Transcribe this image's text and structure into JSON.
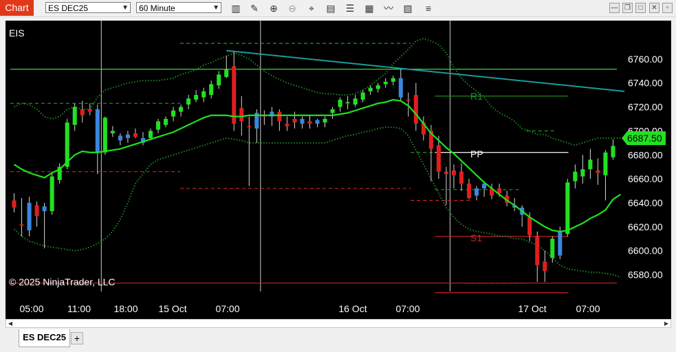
{
  "toolbar": {
    "chart_tab": "Chart",
    "instrument": "ES DEC25",
    "interval": "60 Minute",
    "icons": [
      "bar-type-icon",
      "pencil-icon",
      "zoom-in-icon",
      "zoom-out-icon",
      "crosshair-icon",
      "data-box-icon",
      "properties-icon",
      "strategies-icon",
      "indicators-icon",
      "templates-icon"
    ]
  },
  "window_buttons": {
    "minimize": "—",
    "restore": "❐",
    "maximize": "□",
    "close": "✕"
  },
  "chart": {
    "instrument_label": "EIS",
    "copyright": "© 2025 NinjaTrader, LLC",
    "current_price": "6687.50",
    "level_labels": {
      "r1": "R1",
      "pp": "PP",
      "s1": "S1"
    }
  },
  "chart_data": {
    "type": "candlestick",
    "title": "EIS",
    "y_ticks": [
      "6760.00",
      "6740.00",
      "6720.00",
      "6700.00",
      "6680.00",
      "6660.00",
      "6640.00",
      "6620.00",
      "6600.00",
      "6580.00"
    ],
    "ylim": [
      6566,
      6792
    ],
    "x_ticks": [
      "05:00",
      "11:00",
      "18:00",
      "15 Oct",
      "07:00",
      "16 Oct",
      "07:00",
      "17 Oct",
      "07:00"
    ],
    "candles": [
      {
        "o": 6642,
        "h": 6648,
        "l": 6632,
        "c": 6636,
        "color": "red"
      },
      {
        "o": 6622,
        "h": 6644,
        "l": 6612,
        "c": 6621,
        "color": "red"
      },
      {
        "o": 6617,
        "h": 6645,
        "l": 6612,
        "c": 6640,
        "color": "blue"
      },
      {
        "o": 6638,
        "h": 6641,
        "l": 6620,
        "c": 6629,
        "color": "red"
      },
      {
        "o": 6633,
        "h": 6640,
        "l": 6602,
        "c": 6637,
        "color": "blue"
      },
      {
        "o": 6633,
        "h": 6666,
        "l": 6630,
        "c": 6662,
        "color": "green"
      },
      {
        "o": 6659,
        "h": 6673,
        "l": 6656,
        "c": 6670,
        "color": "green"
      },
      {
        "o": 6670,
        "h": 6710,
        "l": 6668,
        "c": 6707,
        "color": "green"
      },
      {
        "o": 6705,
        "h": 6723,
        "l": 6700,
        "c": 6720,
        "color": "green"
      },
      {
        "o": 6718,
        "h": 6725,
        "l": 6707,
        "c": 6713,
        "color": "red"
      },
      {
        "o": 6718,
        "h": 6723,
        "l": 6713,
        "c": 6716,
        "color": "red"
      },
      {
        "o": 6718,
        "h": 6722,
        "l": 6664,
        "c": 6682,
        "color": "blue"
      },
      {
        "o": 6682,
        "h": 6712,
        "l": 6680,
        "c": 6711,
        "color": "green"
      },
      {
        "o": 6698,
        "h": 6704,
        "l": 6695,
        "c": 6700,
        "color": "green"
      },
      {
        "o": 6692,
        "h": 6698,
        "l": 6688,
        "c": 6696,
        "color": "blue"
      },
      {
        "o": 6694,
        "h": 6700,
        "l": 6690,
        "c": 6697,
        "color": "blue"
      },
      {
        "o": 6698,
        "h": 6702,
        "l": 6694,
        "c": 6695,
        "color": "red"
      },
      {
        "o": 6690,
        "h": 6699,
        "l": 6688,
        "c": 6694,
        "color": "blue"
      },
      {
        "o": 6694,
        "h": 6702,
        "l": 6692,
        "c": 6700,
        "color": "green"
      },
      {
        "o": 6701,
        "h": 6710,
        "l": 6698,
        "c": 6708,
        "color": "green"
      },
      {
        "o": 6705,
        "h": 6712,
        "l": 6703,
        "c": 6710,
        "color": "green"
      },
      {
        "o": 6712,
        "h": 6720,
        "l": 6708,
        "c": 6717,
        "color": "green"
      },
      {
        "o": 6716,
        "h": 6722,
        "l": 6712,
        "c": 6720,
        "color": "green"
      },
      {
        "o": 6722,
        "h": 6730,
        "l": 6718,
        "c": 6727,
        "color": "green"
      },
      {
        "o": 6726,
        "h": 6734,
        "l": 6724,
        "c": 6730,
        "color": "green"
      },
      {
        "o": 6728,
        "h": 6736,
        "l": 6724,
        "c": 6733,
        "color": "green"
      },
      {
        "o": 6730,
        "h": 6742,
        "l": 6727,
        "c": 6739,
        "color": "green"
      },
      {
        "o": 6738,
        "h": 6750,
        "l": 6735,
        "c": 6747,
        "color": "green"
      },
      {
        "o": 6745,
        "h": 6763,
        "l": 6744,
        "c": 6751,
        "color": "green"
      },
      {
        "o": 6754,
        "h": 6767,
        "l": 6700,
        "c": 6706,
        "color": "red"
      },
      {
        "o": 6719,
        "h": 6729,
        "l": 6696,
        "c": 6708,
        "color": "red"
      },
      {
        "o": 6704,
        "h": 6712,
        "l": 6654,
        "c": 6703,
        "color": "red"
      },
      {
        "o": 6702,
        "h": 6718,
        "l": 6690,
        "c": 6715,
        "color": "blue"
      },
      {
        "o": 6713,
        "h": 6717,
        "l": 6705,
        "c": 6712,
        "color": "red"
      },
      {
        "o": 6712,
        "h": 6720,
        "l": 6704,
        "c": 6716,
        "color": "blue"
      },
      {
        "o": 6716,
        "h": 6718,
        "l": 6700,
        "c": 6708,
        "color": "red"
      },
      {
        "o": 6706,
        "h": 6712,
        "l": 6700,
        "c": 6704,
        "color": "red"
      },
      {
        "o": 6710,
        "h": 6716,
        "l": 6702,
        "c": 6707,
        "color": "red"
      },
      {
        "o": 6706,
        "h": 6712,
        "l": 6702,
        "c": 6710,
        "color": "blue"
      },
      {
        "o": 6708,
        "h": 6713,
        "l": 6702,
        "c": 6706,
        "color": "red"
      },
      {
        "o": 6706,
        "h": 6710,
        "l": 6703,
        "c": 6709,
        "color": "blue"
      },
      {
        "o": 6707,
        "h": 6712,
        "l": 6703,
        "c": 6710,
        "color": "green"
      },
      {
        "o": 6715,
        "h": 6720,
        "l": 6710,
        "c": 6718,
        "color": "green"
      },
      {
        "o": 6720,
        "h": 6728,
        "l": 6716,
        "c": 6726,
        "color": "green"
      },
      {
        "o": 6723,
        "h": 6729,
        "l": 6718,
        "c": 6724,
        "color": "green"
      },
      {
        "o": 6722,
        "h": 6730,
        "l": 6720,
        "c": 6727,
        "color": "green"
      },
      {
        "o": 6726,
        "h": 6734,
        "l": 6724,
        "c": 6732,
        "color": "green"
      },
      {
        "o": 6733,
        "h": 6738,
        "l": 6730,
        "c": 6736,
        "color": "green"
      },
      {
        "o": 6735,
        "h": 6740,
        "l": 6732,
        "c": 6738,
        "color": "green"
      },
      {
        "o": 6739,
        "h": 6744,
        "l": 6736,
        "c": 6741,
        "color": "green"
      },
      {
        "o": 6741,
        "h": 6746,
        "l": 6738,
        "c": 6744,
        "color": "green"
      },
      {
        "o": 6744,
        "h": 6752,
        "l": 6725,
        "c": 6728,
        "color": "blue"
      },
      {
        "o": 6726,
        "h": 6732,
        "l": 6712,
        "c": 6726,
        "color": "red"
      },
      {
        "o": 6730,
        "h": 6740,
        "l": 6700,
        "c": 6706,
        "color": "red"
      },
      {
        "o": 6707,
        "h": 6712,
        "l": 6692,
        "c": 6697,
        "color": "red"
      },
      {
        "o": 6700,
        "h": 6705,
        "l": 6658,
        "c": 6685,
        "color": "red"
      },
      {
        "o": 6688,
        "h": 6696,
        "l": 6660,
        "c": 6666,
        "color": "red"
      },
      {
        "o": 6666,
        "h": 6670,
        "l": 6638,
        "c": 6664,
        "color": "red"
      },
      {
        "o": 6667,
        "h": 6672,
        "l": 6652,
        "c": 6663,
        "color": "red"
      },
      {
        "o": 6666,
        "h": 6673,
        "l": 6650,
        "c": 6656,
        "color": "red"
      },
      {
        "o": 6656,
        "h": 6660,
        "l": 6643,
        "c": 6644,
        "color": "red"
      },
      {
        "o": 6646,
        "h": 6654,
        "l": 6642,
        "c": 6652,
        "color": "blue"
      },
      {
        "o": 6656,
        "h": 6658,
        "l": 6645,
        "c": 6652,
        "color": "blue"
      },
      {
        "o": 6652,
        "h": 6656,
        "l": 6643,
        "c": 6646,
        "color": "red"
      },
      {
        "o": 6652,
        "h": 6656,
        "l": 6645,
        "c": 6648,
        "color": "red"
      },
      {
        "o": 6646,
        "h": 6650,
        "l": 6637,
        "c": 6640,
        "color": "red"
      },
      {
        "o": 6638,
        "h": 6644,
        "l": 6633,
        "c": 6636,
        "color": "blue"
      },
      {
        "o": 6630,
        "h": 6638,
        "l": 6620,
        "c": 6636,
        "color": "blue"
      },
      {
        "o": 6628,
        "h": 6632,
        "l": 6608,
        "c": 6613,
        "color": "red"
      },
      {
        "o": 6612,
        "h": 6616,
        "l": 6574,
        "c": 6588,
        "color": "red"
      },
      {
        "o": 6583,
        "h": 6600,
        "l": 6574,
        "c": 6591,
        "color": "red"
      },
      {
        "o": 6594,
        "h": 6612,
        "l": 6590,
        "c": 6610,
        "color": "green"
      },
      {
        "o": 6596,
        "h": 6620,
        "l": 6593,
        "c": 6616,
        "color": "blue"
      },
      {
        "o": 6614,
        "h": 6660,
        "l": 6612,
        "c": 6657,
        "color": "green"
      },
      {
        "o": 6658,
        "h": 6672,
        "l": 6652,
        "c": 6666,
        "color": "green"
      },
      {
        "o": 6662,
        "h": 6680,
        "l": 6656,
        "c": 6668,
        "color": "green"
      },
      {
        "o": 6668,
        "h": 6685,
        "l": 6660,
        "c": 6676,
        "color": "green"
      },
      {
        "o": 6665,
        "h": 6677,
        "l": 6655,
        "c": 6667,
        "color": "red"
      },
      {
        "o": 6663,
        "h": 6684,
        "l": 6642,
        "c": 6682,
        "color": "green"
      },
      {
        "o": 6678,
        "h": 6693,
        "l": 6676,
        "c": 6687.5,
        "color": "green"
      }
    ],
    "moving_average": {
      "color": "#1ee31e",
      "y": [
        6672,
        6668,
        6665,
        6663,
        6661,
        6665,
        6668,
        6674,
        6680,
        6683,
        6682,
        6682,
        6683,
        6684,
        6685,
        6687,
        6689,
        6691,
        6693,
        6695,
        6697,
        6699,
        6702,
        6705,
        6708,
        6711,
        6713,
        6713,
        6713,
        6712,
        6712,
        6713,
        6713,
        6713,
        6713,
        6713,
        6713,
        6713,
        6713,
        6713,
        6713,
        6713,
        6713,
        6714,
        6715,
        6717,
        6719,
        6721,
        6723,
        6724,
        6726,
        6725,
        6721,
        6714,
        6706,
        6698,
        6692,
        6686,
        6681,
        6675,
        6669,
        6663,
        6657,
        6652,
        6647,
        6642,
        6638,
        6633,
        6628,
        6624,
        6620,
        6617,
        6616,
        6617,
        6620,
        6623,
        6627,
        6630,
        6634,
        6643,
        6647
      ]
    },
    "bollinger_upper": {
      "color": "#1e8a1e",
      "style": "dotted",
      "y": [
        6720,
        6723,
        6722,
        6718,
        6712,
        6710,
        6712,
        6718,
        6720,
        6718,
        6718,
        6728,
        6734,
        6736,
        6738,
        6740,
        6741,
        6742,
        6742,
        6742,
        6743,
        6744,
        6747,
        6749,
        6751,
        6755,
        6757,
        6760,
        6762,
        6765,
        6763,
        6760,
        6755,
        6750,
        6746,
        6743,
        6740,
        6738,
        6736,
        6734,
        6732,
        6731,
        6731,
        6730,
        6730,
        6731,
        6734,
        6738,
        6743,
        6748,
        6756,
        6762,
        6768,
        6775,
        6777,
        6775,
        6772,
        6765,
        6753,
        6744,
        6738,
        6733,
        6728,
        6720,
        6715,
        6712,
        6708,
        6702,
        6700,
        6697,
        6697,
        6694,
        6692,
        6690,
        6688,
        6690,
        6692,
        6694,
        6694,
        6694,
        6694
      ]
    },
    "bollinger_lower": {
      "color": "#1e8a1e",
      "style": "dotted",
      "y": [
        6618,
        6612,
        6608,
        6606,
        6604,
        6603,
        6602,
        6601,
        6600,
        6601,
        6603,
        6606,
        6610,
        6616,
        6626,
        6640,
        6656,
        6664,
        6672,
        6676,
        6678,
        6680,
        6682,
        6684,
        6686,
        6688,
        6690,
        6692,
        6694,
        6693,
        6692,
        6690,
        6690,
        6690,
        6690,
        6690,
        6690,
        6690,
        6690,
        6690,
        6690,
        6690,
        6692,
        6694,
        6696,
        6697,
        6699,
        6700,
        6702,
        6703,
        6703,
        6702,
        6696,
        6684,
        6672,
        6660,
        6648,
        6636,
        6628,
        6622,
        6618,
        6616,
        6615,
        6614,
        6612,
        6612,
        6610,
        6610,
        6607,
        6605,
        6600,
        6594,
        6588,
        6585,
        6584,
        6583,
        6582,
        6582,
        6581,
        6580,
        6578
      ]
    },
    "levels": [
      {
        "y": 6751.5,
        "color": "#39d839",
        "style": "solid",
        "x0": 0,
        "x1": 1
      },
      {
        "y": 6773,
        "color": "#1f9a1f",
        "style": "dashed",
        "x0": 0.28,
        "x1": 0.66
      },
      {
        "y": 6723,
        "color": "#1f9a1f",
        "style": "dashed",
        "x0": 0,
        "x1": 0.28
      },
      {
        "y": 6666,
        "color": "#d32222",
        "style": "dashed",
        "x0": 0,
        "x1": 0.28
      },
      {
        "y": 6652,
        "color": "#d32222",
        "style": "dashed",
        "x0": 0.28,
        "x1": 0.66
      },
      {
        "y": 6729,
        "color": "#1f9a1f",
        "style": "solid",
        "x0": 0.7,
        "x1": 0.92
      },
      {
        "y": 6682,
        "color": "#ffffff",
        "style": "solid",
        "x0": 0.7,
        "x1": 0.92
      },
      {
        "y": 6682,
        "color": "#1f9a1f",
        "style": "dashed",
        "x0": 0.66,
        "x1": 0.7
      },
      {
        "y": 6651,
        "color": "#1f9a1f",
        "style": "dashed",
        "x0": 0.7,
        "x1": 0.84
      },
      {
        "y": 6642,
        "color": "#d32222",
        "style": "dashed",
        "x0": 0.66,
        "x1": 0.76
      },
      {
        "y": 6612,
        "color": "#d32222",
        "style": "solid",
        "x0": 0.7,
        "x1": 0.92
      },
      {
        "y": 6573,
        "color": "#d32222",
        "style": "solid",
        "x0": 0,
        "x1": 1
      },
      {
        "y": 6573,
        "color": "#d32222",
        "style": "dashed",
        "x0": 0.75,
        "x1": 0.85
      },
      {
        "y": 6565,
        "color": "#d32222",
        "style": "solid",
        "x0": 0.7,
        "x1": 0.92
      },
      {
        "y": 6700,
        "color": "#1f9a1f",
        "style": "dashed",
        "x0": 0.85,
        "x1": 0.9
      }
    ],
    "trendline": {
      "color": "#1a9b9b",
      "from": {
        "i": 28,
        "y": 6767
      },
      "to": {
        "i": 80.5,
        "y": 6733
      }
    },
    "session_breaks": [
      11.5,
      32.5,
      57.5
    ]
  }
}
